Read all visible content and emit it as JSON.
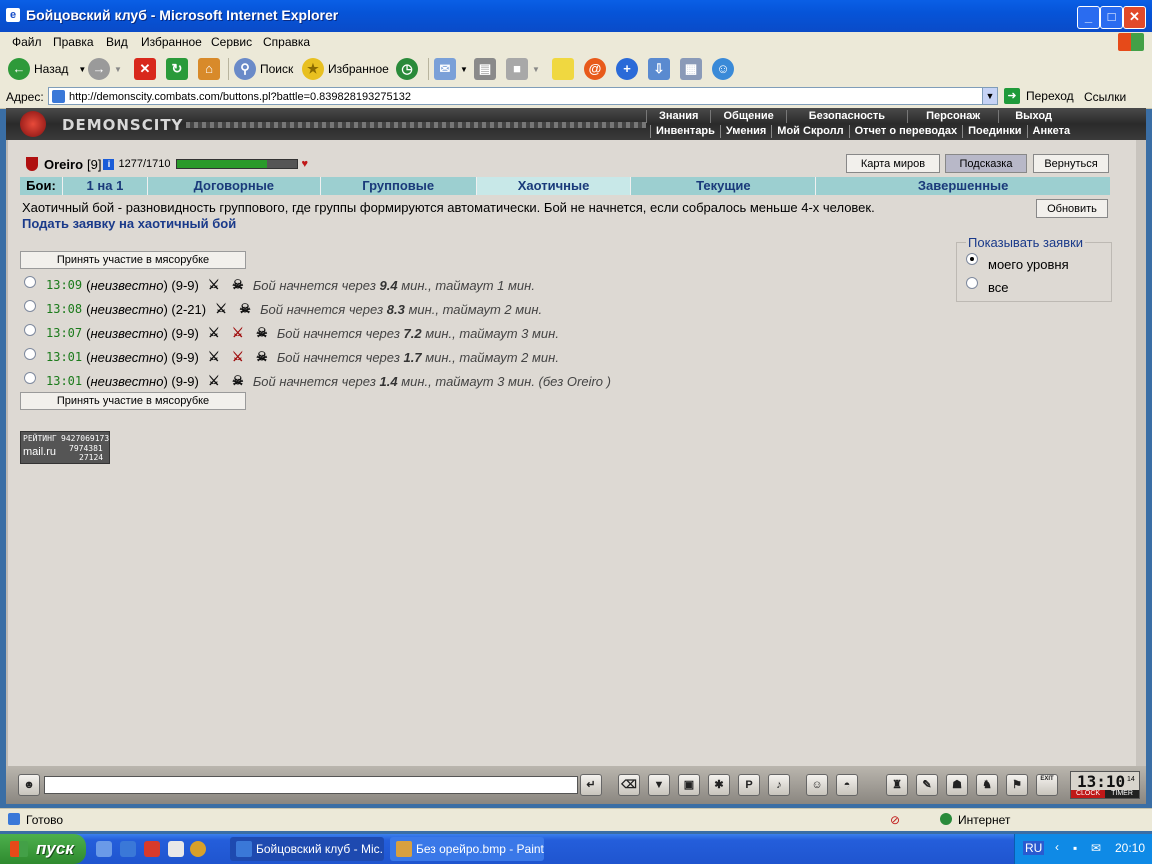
{
  "window": {
    "title": "Бойцовский клуб - Microsoft Internet Explorer",
    "min": "_",
    "max": "□",
    "close": "✕"
  },
  "menu": [
    "Файл",
    "Правка",
    "Вид",
    "Избранное",
    "Сервис",
    "Справка"
  ],
  "toolbar": {
    "back": "Назад",
    "search": "Поиск",
    "favorites": "Избранное"
  },
  "address": {
    "label": "Адрес:",
    "url": "http://demonscity.combats.com/buttons.pl?battle=0.839828193275132",
    "go": "Переход",
    "links": "Ссылки"
  },
  "game": {
    "logo": "DEMONSCITY",
    "topnav": [
      "Знания",
      "Общение",
      "Безопасность",
      "Персонаж",
      "Выход"
    ],
    "subnav": [
      "Инвентарь",
      "Умения",
      "Мой Скролл",
      "Отчет о переводах",
      "Поединки",
      "Анкета"
    ]
  },
  "character": {
    "name": "Oreiro",
    "level": "[9]",
    "info": "i",
    "hp": "1277/1710",
    "hp_fraction": 0.747
  },
  "buttons": {
    "map": "Карта миров",
    "hint": "Подсказка",
    "back": "Вернуться",
    "refresh": "Обновить",
    "join": "Принять участие в мясорубке"
  },
  "tabs": [
    "Бои:",
    "1 на 1",
    "Договорные",
    "Групповые",
    "Хаотичные",
    "Текущие",
    "Завершенные"
  ],
  "description": "Хаотичный бой - разновидность группового, где группы формируются автоматически. Бой не начнется, если собралось меньше 4-х человек.",
  "request_link": "Подать заявку на хаотичный бой",
  "filter": {
    "title": "Показывать заявки",
    "options": [
      "моего уровня",
      "все"
    ],
    "selected": 0
  },
  "fights": [
    {
      "time": "13:09",
      "who": "неизвестно",
      "range": "(9-9)",
      "eta_pre": "Бой начнется через",
      "eta": "9.4",
      "eta_post": "мин., таймаут 1 мин."
    },
    {
      "time": "13:08",
      "who": "неизвестно",
      "range": "(2-21)",
      "eta_pre": "Бой начнется через",
      "eta": "8.3",
      "eta_post": "мин., таймаут 2 мин."
    },
    {
      "time": "13:07",
      "who": "неизвестно",
      "range": "(9-9)",
      "eta_pre": "Бой начнется через",
      "eta": "7.2",
      "eta_post": "мин., таймаут 3 мин."
    },
    {
      "time": "13:01",
      "who": "неизвестно",
      "range": "(9-9)",
      "eta_pre": "Бой начнется через",
      "eta": "1.7",
      "eta_post": "мин., таймаут 2 мин."
    },
    {
      "time": "13:01",
      "who": "неизвестно",
      "range": "(9-9)",
      "eta_pre": "Бой начнется через",
      "eta": "1.4",
      "eta_post": "мин., таймаут 3 мин. (без Oreiro )"
    }
  ],
  "counter": {
    "label": "РЕЙТИНГ",
    "brand": "mail.ru",
    "n1": "9427069173",
    "n2": "7974381",
    "n3": "27124"
  },
  "clock": {
    "time": "13:10",
    "sec": "14",
    "clock": "CLOCK",
    "timer": "TIMER",
    "exit": "EXIT"
  },
  "status": {
    "left": "Готово",
    "zone": "Интернет"
  },
  "taskbar": {
    "start": "пуск",
    "tasks": [
      "Бойцовский клуб - Mic...",
      "Без орейро.bmp - Paint"
    ],
    "lang": "RU",
    "time": "20:10"
  }
}
